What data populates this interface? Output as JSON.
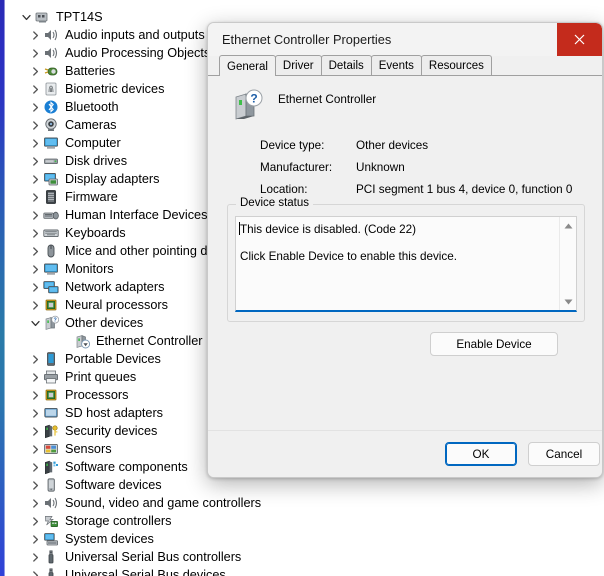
{
  "window": {
    "name": "device-manager",
    "root_label": "TPT14S"
  },
  "tree": {
    "root": {
      "label": "TPT14S",
      "icon": "computer-node-icon",
      "expanded": true
    },
    "items": [
      {
        "label": "Audio inputs and outputs",
        "icon": "speaker-icon",
        "expanded": false,
        "level": 1
      },
      {
        "label": "Audio Processing Objects (APOs)",
        "icon": "speaker-icon",
        "expanded": false,
        "level": 1
      },
      {
        "label": "Batteries",
        "icon": "battery-icon",
        "expanded": false,
        "level": 1
      },
      {
        "label": "Biometric devices",
        "icon": "fingerprint-icon",
        "expanded": false,
        "level": 1
      },
      {
        "label": "Bluetooth",
        "icon": "bluetooth-icon",
        "expanded": false,
        "level": 1
      },
      {
        "label": "Cameras",
        "icon": "camera-icon",
        "expanded": false,
        "level": 1
      },
      {
        "label": "Computer",
        "icon": "monitor-icon",
        "expanded": false,
        "level": 1
      },
      {
        "label": "Disk drives",
        "icon": "disk-icon",
        "expanded": false,
        "level": 1
      },
      {
        "label": "Display adapters",
        "icon": "display-adapter-icon",
        "expanded": false,
        "level": 1
      },
      {
        "label": "Firmware",
        "icon": "firmware-icon",
        "expanded": false,
        "level": 1
      },
      {
        "label": "Human Interface Devices",
        "icon": "hid-icon",
        "expanded": false,
        "level": 1
      },
      {
        "label": "Keyboards",
        "icon": "keyboard-icon",
        "expanded": false,
        "level": 1
      },
      {
        "label": "Mice and other pointing devices",
        "icon": "mouse-icon",
        "expanded": false,
        "level": 1
      },
      {
        "label": "Monitors",
        "icon": "monitor-icon",
        "expanded": false,
        "level": 1
      },
      {
        "label": "Network adapters",
        "icon": "network-adapter-icon",
        "expanded": false,
        "level": 1
      },
      {
        "label": "Neural processors",
        "icon": "chip-icon",
        "expanded": false,
        "level": 1
      },
      {
        "label": "Other devices",
        "icon": "unknown-device-icon",
        "expanded": true,
        "level": 1
      },
      {
        "label": "Ethernet Controller",
        "icon": "disabled-device-icon",
        "expanded": null,
        "level": 2
      },
      {
        "label": "Portable Devices",
        "icon": "portable-device-icon",
        "expanded": false,
        "level": 1
      },
      {
        "label": "Print queues",
        "icon": "printer-icon",
        "expanded": false,
        "level": 1
      },
      {
        "label": "Processors",
        "icon": "chip-icon",
        "expanded": false,
        "level": 1
      },
      {
        "label": "SD host adapters",
        "icon": "sd-adapter-icon",
        "expanded": false,
        "level": 1
      },
      {
        "label": "Security devices",
        "icon": "security-device-icon",
        "expanded": false,
        "level": 1
      },
      {
        "label": "Sensors",
        "icon": "sensors-icon",
        "expanded": false,
        "level": 1
      },
      {
        "label": "Software components",
        "icon": "software-component-icon",
        "expanded": false,
        "level": 1
      },
      {
        "label": "Software devices",
        "icon": "software-device-icon",
        "expanded": false,
        "level": 1
      },
      {
        "label": "Sound, video and game controllers",
        "icon": "speaker-icon",
        "expanded": false,
        "level": 1
      },
      {
        "label": "Storage controllers",
        "icon": "storage-controller-icon",
        "expanded": false,
        "level": 1
      },
      {
        "label": "System devices",
        "icon": "system-device-icon",
        "expanded": false,
        "level": 1
      },
      {
        "label": "Universal Serial Bus controllers",
        "icon": "usb-icon",
        "expanded": false,
        "level": 1
      },
      {
        "label": "Universal Serial Bus devices",
        "icon": "usb-icon",
        "expanded": false,
        "level": 1
      }
    ]
  },
  "dialog": {
    "title": "Ethernet Controller Properties",
    "close_icon": "close-icon",
    "tabs": [
      {
        "label": "General",
        "active": true
      },
      {
        "label": "Driver",
        "active": false
      },
      {
        "label": "Details",
        "active": false
      },
      {
        "label": "Events",
        "active": false
      },
      {
        "label": "Resources",
        "active": false
      }
    ],
    "device": {
      "name": "Ethernet Controller",
      "icon": "unknown-device-large-icon",
      "properties": [
        {
          "key": "Device type:",
          "value": "Other devices"
        },
        {
          "key": "Manufacturer:",
          "value": "Unknown"
        },
        {
          "key": "Location:",
          "value": "PCI segment 1 bus 4, device 0, function 0"
        }
      ]
    },
    "device_status": {
      "legend": "Device status",
      "line1": "This device is disabled. (Code 22)",
      "line2": "Click Enable Device to enable this device.",
      "scroll_up_icon": "scroll-up-arrow-icon",
      "scroll_down_icon": "scroll-down-arrow-icon"
    },
    "enable_button": "Enable Device",
    "ok_button": "OK",
    "cancel_button": "Cancel"
  },
  "colors": {
    "accent_blue": "#0067c0",
    "close_red": "#c42b1c",
    "dialog_bg": "#f0f0f0",
    "field_bg": "#fbfbfb"
  }
}
